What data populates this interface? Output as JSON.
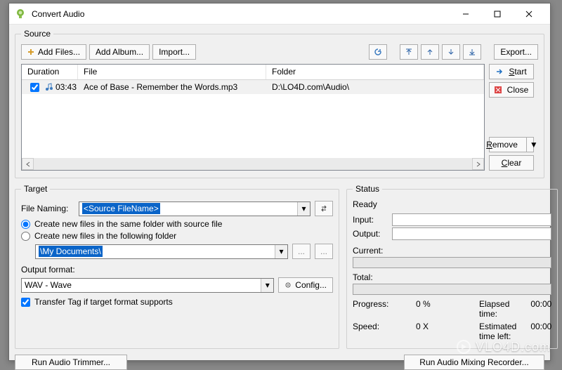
{
  "window": {
    "title": "Convert Audio"
  },
  "source": {
    "legend": "Source",
    "add_files": "Add Files...",
    "add_album": "Add Album...",
    "import": "Import...",
    "export": "Export...",
    "cols": {
      "duration": "Duration",
      "file": "File",
      "folder": "Folder"
    },
    "rows": [
      {
        "checked": true,
        "duration": "03:43",
        "file": "Ace of Base - Remember the Words.mp3",
        "folder": "D:\\LO4D.com\\Audio\\"
      }
    ],
    "start": "Start",
    "close": "Close",
    "remove": "Remove",
    "clear": "Clear"
  },
  "target": {
    "legend": "Target",
    "file_naming_label": "File Naming:",
    "file_naming_value": "<Source FileName>",
    "radio_same": "Create new files in the same folder with source file",
    "radio_other": "Create new files in the following folder",
    "folder_value": "\\My Documents\\",
    "output_format_label": "Output format:",
    "output_format_value": "WAV - Wave",
    "config": "Config...",
    "transfer_tag": "Transfer Tag if target format supports"
  },
  "status": {
    "legend": "Status",
    "ready": "Ready",
    "input": "Input:",
    "output": "Output:",
    "current": "Current:",
    "total": "Total:",
    "progress_label": "Progress:",
    "progress_value": "0 %",
    "speed_label": "Speed:",
    "speed_value": "0 X",
    "elapsed_label": "Elapsed time:",
    "elapsed_value": "00:00",
    "remaining_label": "Estimated time left:",
    "remaining_value": "00:00"
  },
  "footer": {
    "run_trimmer": "Run Audio Trimmer...",
    "run_mixer": "Run Audio Mixing Recorder..."
  },
  "watermark": "VLO4D.com"
}
